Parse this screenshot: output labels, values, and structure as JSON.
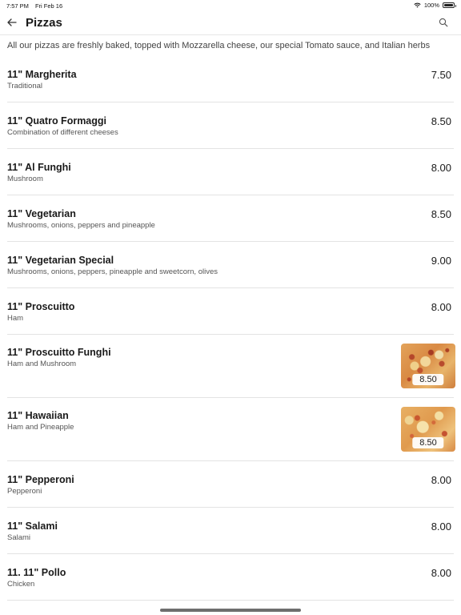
{
  "status_bar": {
    "time": "7:57 PM",
    "date": "Fri Feb 16",
    "battery": "100%"
  },
  "nav": {
    "title": "Pizzas"
  },
  "description": "All our pizzas are freshly baked, topped with Mozzarella cheese, our special Tomato sauce, and Italian herbs",
  "items": [
    {
      "name": "11\" Margherita",
      "desc": "Traditional",
      "price": "7.50"
    },
    {
      "name": "11\" Quatro Formaggi",
      "desc": "Combination of different cheeses",
      "price": "8.50"
    },
    {
      "name": "11\" Al Funghi",
      "desc": "Mushroom",
      "price": "8.00"
    },
    {
      "name": "11\" Vegetarian",
      "desc": "Mushrooms, onions, peppers and pineapple",
      "price": "8.50"
    },
    {
      "name": "11\" Vegetarian Special",
      "desc": "Mushrooms, onions, peppers, pineapple and sweetcorn, olives",
      "price": "9.00"
    },
    {
      "name": "11\" Proscuitto",
      "desc": "Ham",
      "price": "8.00"
    },
    {
      "name": "11\" Proscuitto Funghi",
      "desc": "Ham and Mushroom",
      "price": "8.50",
      "image": true
    },
    {
      "name": "11\" Hawaiian",
      "desc": "Ham and Pineapple",
      "price": "8.50",
      "image": true
    },
    {
      "name": "11\" Pepperoni",
      "desc": "Pepperoni",
      "price": "8.00"
    },
    {
      "name": "11\" Salami",
      "desc": "Salami",
      "price": "8.00"
    },
    {
      "name": "11. 11\" Pollo",
      "desc": "Chicken",
      "price": "8.00"
    }
  ]
}
